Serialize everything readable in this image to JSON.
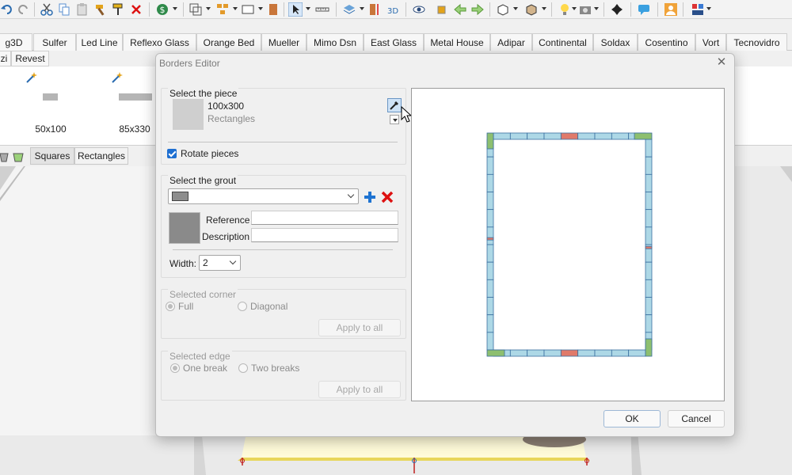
{
  "toolbar": {
    "icons": [
      "undo-icon",
      "redo-icon",
      "cut-icon",
      "copy-icon",
      "paste-icon",
      "hammer-icon",
      "paint-roller-icon",
      "delete-icon",
      "price-icon",
      "frame-icon",
      "group-icon",
      "rectangle-icon",
      "door-icon",
      "pointer-icon",
      "ruler-icon",
      "layers-icon",
      "distribute-icon",
      "3d-icon",
      "eye-icon",
      "cube-arrow-icon",
      "arrow-left-icon",
      "arrow-right-icon",
      "box-icon",
      "package-icon",
      "bulb-icon",
      "camera-icon",
      "move-icon",
      "comment-icon",
      "user-icon",
      "palette-icon"
    ],
    "label_3d": "3D"
  },
  "catalog_tabs": [
    "g3D",
    "Sulfer",
    "Led Line",
    "Reflexo Glass",
    "Orange Bed",
    "Mueller",
    "Mimo Dsn",
    "East Glass",
    "Metal House",
    "Adipar",
    "Continental",
    "Soldax",
    "Cosentino",
    "Vort",
    "Tecnovidro"
  ],
  "sub_tabs": [
    "zi",
    "Revest"
  ],
  "pieces": [
    {
      "label": "50x100"
    },
    {
      "label": "85x330"
    }
  ],
  "shape_tabs": [
    "Squares",
    "Rectangles"
  ],
  "dialog": {
    "title": "Borders Editor",
    "close": "✕",
    "piece_group": {
      "title": "Select the piece",
      "name": "100x300",
      "type": "Rectangles",
      "rotate_label": "Rotate pieces",
      "rotate_checked": true
    },
    "grout_group": {
      "title": "Select the grout",
      "selected": "",
      "reference_label": "Reference",
      "reference_value": "",
      "description_label": "Description",
      "description_value": "",
      "width_label": "Width:",
      "width_value": "2",
      "swatch_color": "#8a8a8a"
    },
    "corner_group": {
      "title": "Selected corner",
      "option_full": "Full",
      "option_diagonal": "Diagonal",
      "selected": "Full",
      "apply": "Apply to all"
    },
    "edge_group": {
      "title": "Selected edge",
      "option_one": "One break",
      "option_two": "Two breaks",
      "selected": "One break",
      "apply": "Apply to all"
    },
    "ok": "OK",
    "cancel": "Cancel"
  },
  "preview": {
    "tile_color": "#add8e6",
    "corner_color": "#8dbf6f",
    "break_color": "#e07a6a",
    "grout_color": "#3a6fa0",
    "top_pieces": 9,
    "bottom_pieces": 9,
    "side_pieces": 12
  }
}
